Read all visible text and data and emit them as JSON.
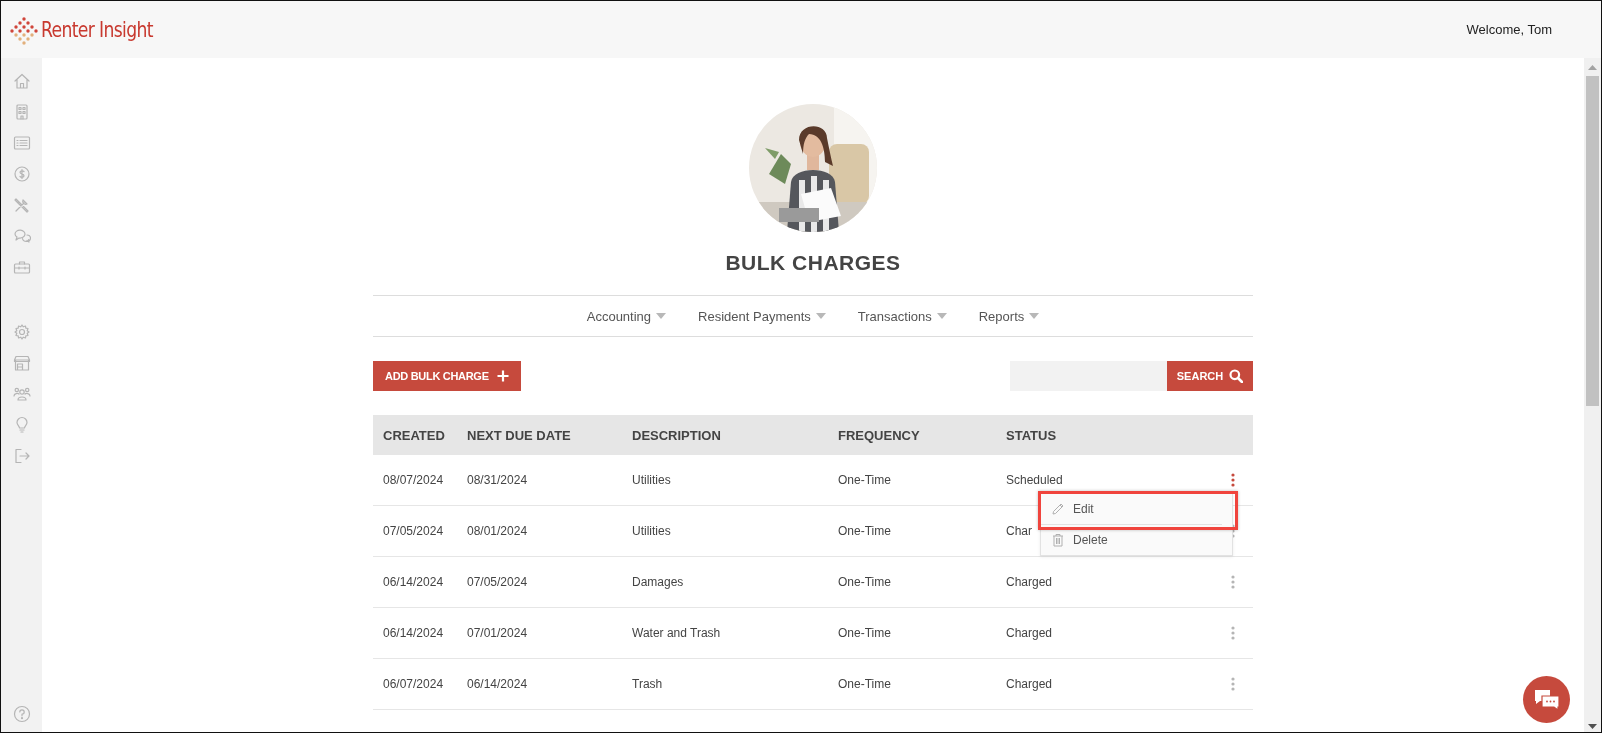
{
  "header": {
    "logo": "Renter Insight",
    "welcome": "Welcome, Tom"
  },
  "page": {
    "title": "BULK CHARGES"
  },
  "nav": [
    {
      "label": "Accounting"
    },
    {
      "label": "Resident Payments"
    },
    {
      "label": "Transactions"
    },
    {
      "label": "Reports"
    }
  ],
  "toolbar": {
    "add_button": "ADD BULK CHARGE",
    "search_button": "SEARCH"
  },
  "table": {
    "columns": [
      "CREATED",
      "NEXT DUE DATE",
      "DESCRIPTION",
      "FREQUENCY",
      "STATUS"
    ],
    "rows": [
      {
        "cells": [
          "08/07/2024",
          "08/31/2024",
          "Utilities",
          "One-Time",
          "Scheduled"
        ],
        "menu_open": true
      },
      {
        "cells": [
          "07/05/2024",
          "08/01/2024",
          "Utilities",
          "One-Time",
          "Char"
        ],
        "menu_open": false
      },
      {
        "cells": [
          "06/14/2024",
          "07/05/2024",
          "Damages",
          "One-Time",
          "Charged"
        ],
        "menu_open": false
      },
      {
        "cells": [
          "06/14/2024",
          "07/01/2024",
          "Water and Trash",
          "One-Time",
          "Charged"
        ],
        "menu_open": false
      },
      {
        "cells": [
          "06/07/2024",
          "06/14/2024",
          "Trash",
          "One-Time",
          "Charged"
        ],
        "menu_open": false
      }
    ]
  },
  "row_menu": {
    "items": [
      {
        "label": "Edit",
        "kind": "edit",
        "highlighted": true
      },
      {
        "label": "Delete",
        "kind": "delete",
        "highlighted": false
      }
    ]
  }
}
